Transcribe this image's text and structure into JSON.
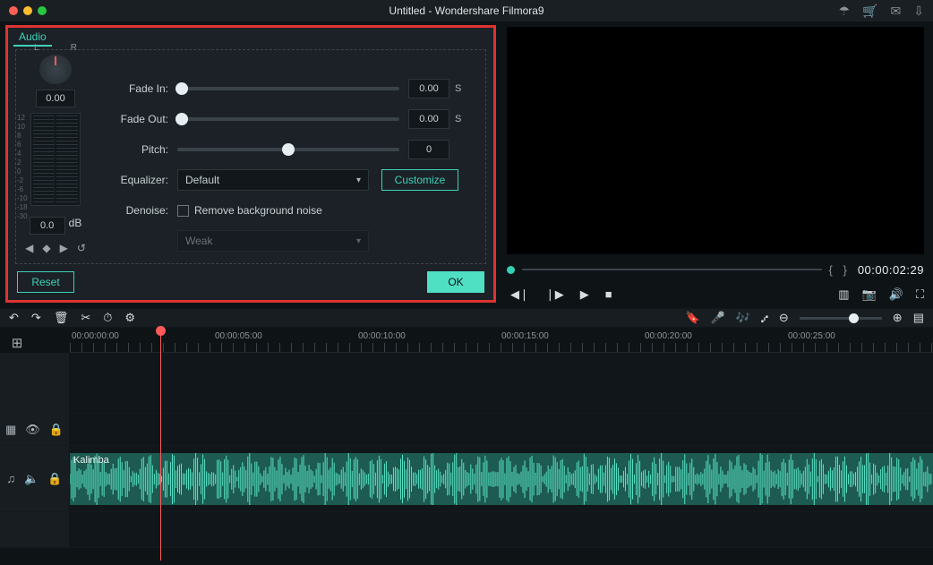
{
  "title": "Untitled - Wondershare Filmora9",
  "panel": {
    "tab": "Audio",
    "balance_value": "0.00",
    "balance_L": "L",
    "balance_R": "R",
    "vu_ticks": [
      "12",
      "10",
      "8",
      "6",
      "4",
      "2",
      "0",
      "-2",
      "-6",
      "-10",
      "-18",
      "-30"
    ],
    "db_value": "0.0",
    "db_suffix": "dB",
    "fade_in": {
      "label": "Fade In:",
      "value": "0.00",
      "unit": "S"
    },
    "fade_out": {
      "label": "Fade Out:",
      "value": "0.00",
      "unit": "S"
    },
    "pitch": {
      "label": "Pitch:",
      "value": "0"
    },
    "equalizer": {
      "label": "Equalizer:",
      "selected": "Default",
      "customize": "Customize"
    },
    "denoise": {
      "label": "Denoise:",
      "checkbox": "Remove background noise",
      "strength": "Weak"
    },
    "reset": "Reset",
    "ok": "OK"
  },
  "preview": {
    "timecode": "00:00:02:29"
  },
  "ruler": [
    "00:00:00:00",
    "00:00:05:00",
    "00:00:10:00",
    "00:00:15:00",
    "00:00:20:00",
    "00:00:25:00"
  ],
  "clip": {
    "name": "Kalimba"
  }
}
